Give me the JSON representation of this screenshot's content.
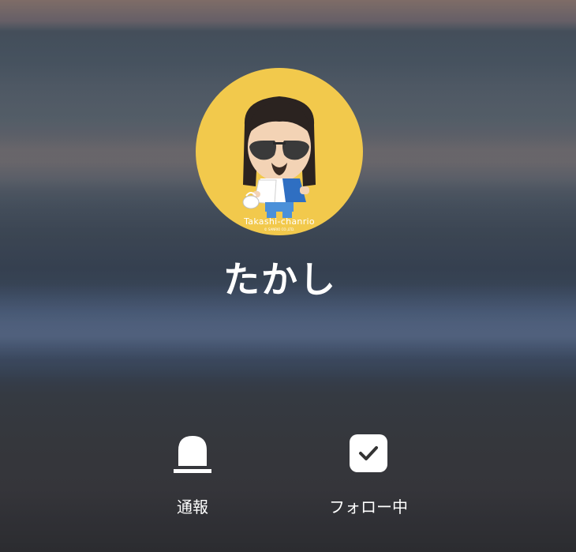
{
  "profile": {
    "name": "たかし",
    "avatar": {
      "caption": "Takashi-chanrio",
      "copyright": "© SANRIO CO.,LTD.",
      "background_color": "#f2c94c"
    }
  },
  "actions": {
    "report": {
      "label": "通報",
      "icon": "report-bell-icon"
    },
    "following": {
      "label": "フォロー中",
      "icon": "checkmark-icon"
    }
  },
  "colors": {
    "text": "#ffffff",
    "avatar_bg": "#f2c94c"
  }
}
